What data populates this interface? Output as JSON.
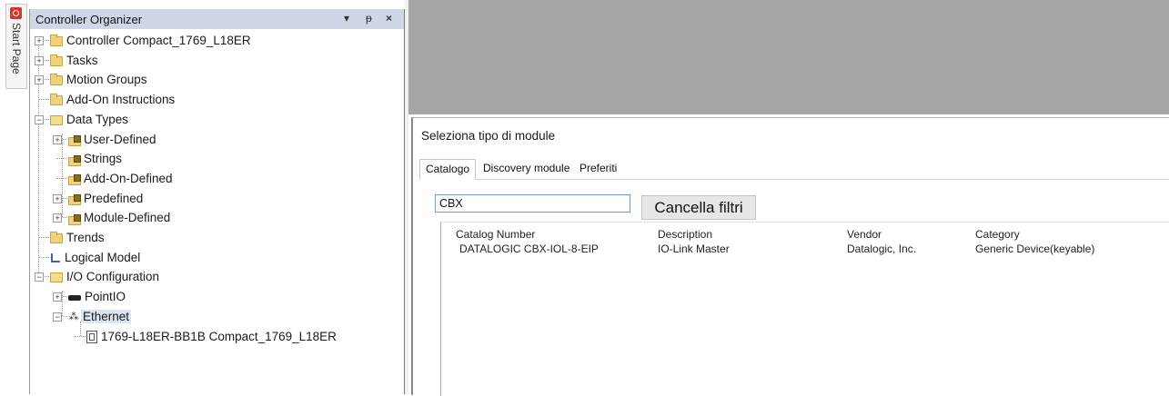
{
  "start_page": {
    "label": "Start Page"
  },
  "organizer": {
    "title": "Controller Organizer",
    "controls": {
      "dropdown": "▾",
      "pin": "ᵽ",
      "close": "×"
    },
    "tree": [
      {
        "label": "Controller Compact_1769_L18ER",
        "icon": "folder-icon",
        "expander": "+"
      },
      {
        "label": "Tasks",
        "icon": "folder-icon",
        "expander": "+"
      },
      {
        "label": "Motion Groups",
        "icon": "folder-icon",
        "expander": "+"
      },
      {
        "label": "Add-On Instructions",
        "icon": "folder-icon",
        "expander": ""
      },
      {
        "label": "Data Types",
        "icon": "folder-open-icon",
        "expander": "−"
      },
      {
        "label": "User-Defined",
        "icon": "datatype-icon",
        "expander": "+"
      },
      {
        "label": "Strings",
        "icon": "datatype-icon",
        "expander": ""
      },
      {
        "label": "Add-On-Defined",
        "icon": "datatype-icon",
        "expander": ""
      },
      {
        "label": "Predefined",
        "icon": "datatype-icon",
        "expander": "+"
      },
      {
        "label": "Module-Defined",
        "icon": "datatype-icon",
        "expander": "+"
      },
      {
        "label": "Trends",
        "icon": "folder-icon",
        "expander": ""
      },
      {
        "label": "Logical Model",
        "icon": "model-icon",
        "expander": ""
      },
      {
        "label": "I/O Configuration",
        "icon": "folder-open-icon",
        "expander": "−"
      },
      {
        "label": "PointIO",
        "icon": "pointio-icon",
        "expander": "+"
      },
      {
        "label": "Ethernet",
        "icon": "ethernet-icon",
        "expander": "−"
      },
      {
        "label": "1769-L18ER-BB1B Compact_1769_L18ER",
        "icon": "module-icon",
        "expander": ""
      }
    ]
  },
  "dialog": {
    "title": "Seleziona tipo di module",
    "tabs": [
      "Catalogo",
      "Discovery module",
      "Preferiti"
    ],
    "filter": {
      "value": "CBX"
    },
    "clear_filters_label": "Cancella filtri",
    "columns": [
      "Catalog Number",
      "Description",
      "Vendor",
      "Category"
    ],
    "rows": [
      {
        "catalog_number": "DATALOGIC CBX-IOL-8-EIP",
        "description": "IO-Link Master",
        "vendor": "Datalogic, Inc.",
        "category": "Generic Device(keyable)"
      }
    ]
  },
  "colors": {
    "title_bar": "#cfd6e5",
    "grey_workspace": "#a6a6a6",
    "selection": "#dce4f0"
  }
}
